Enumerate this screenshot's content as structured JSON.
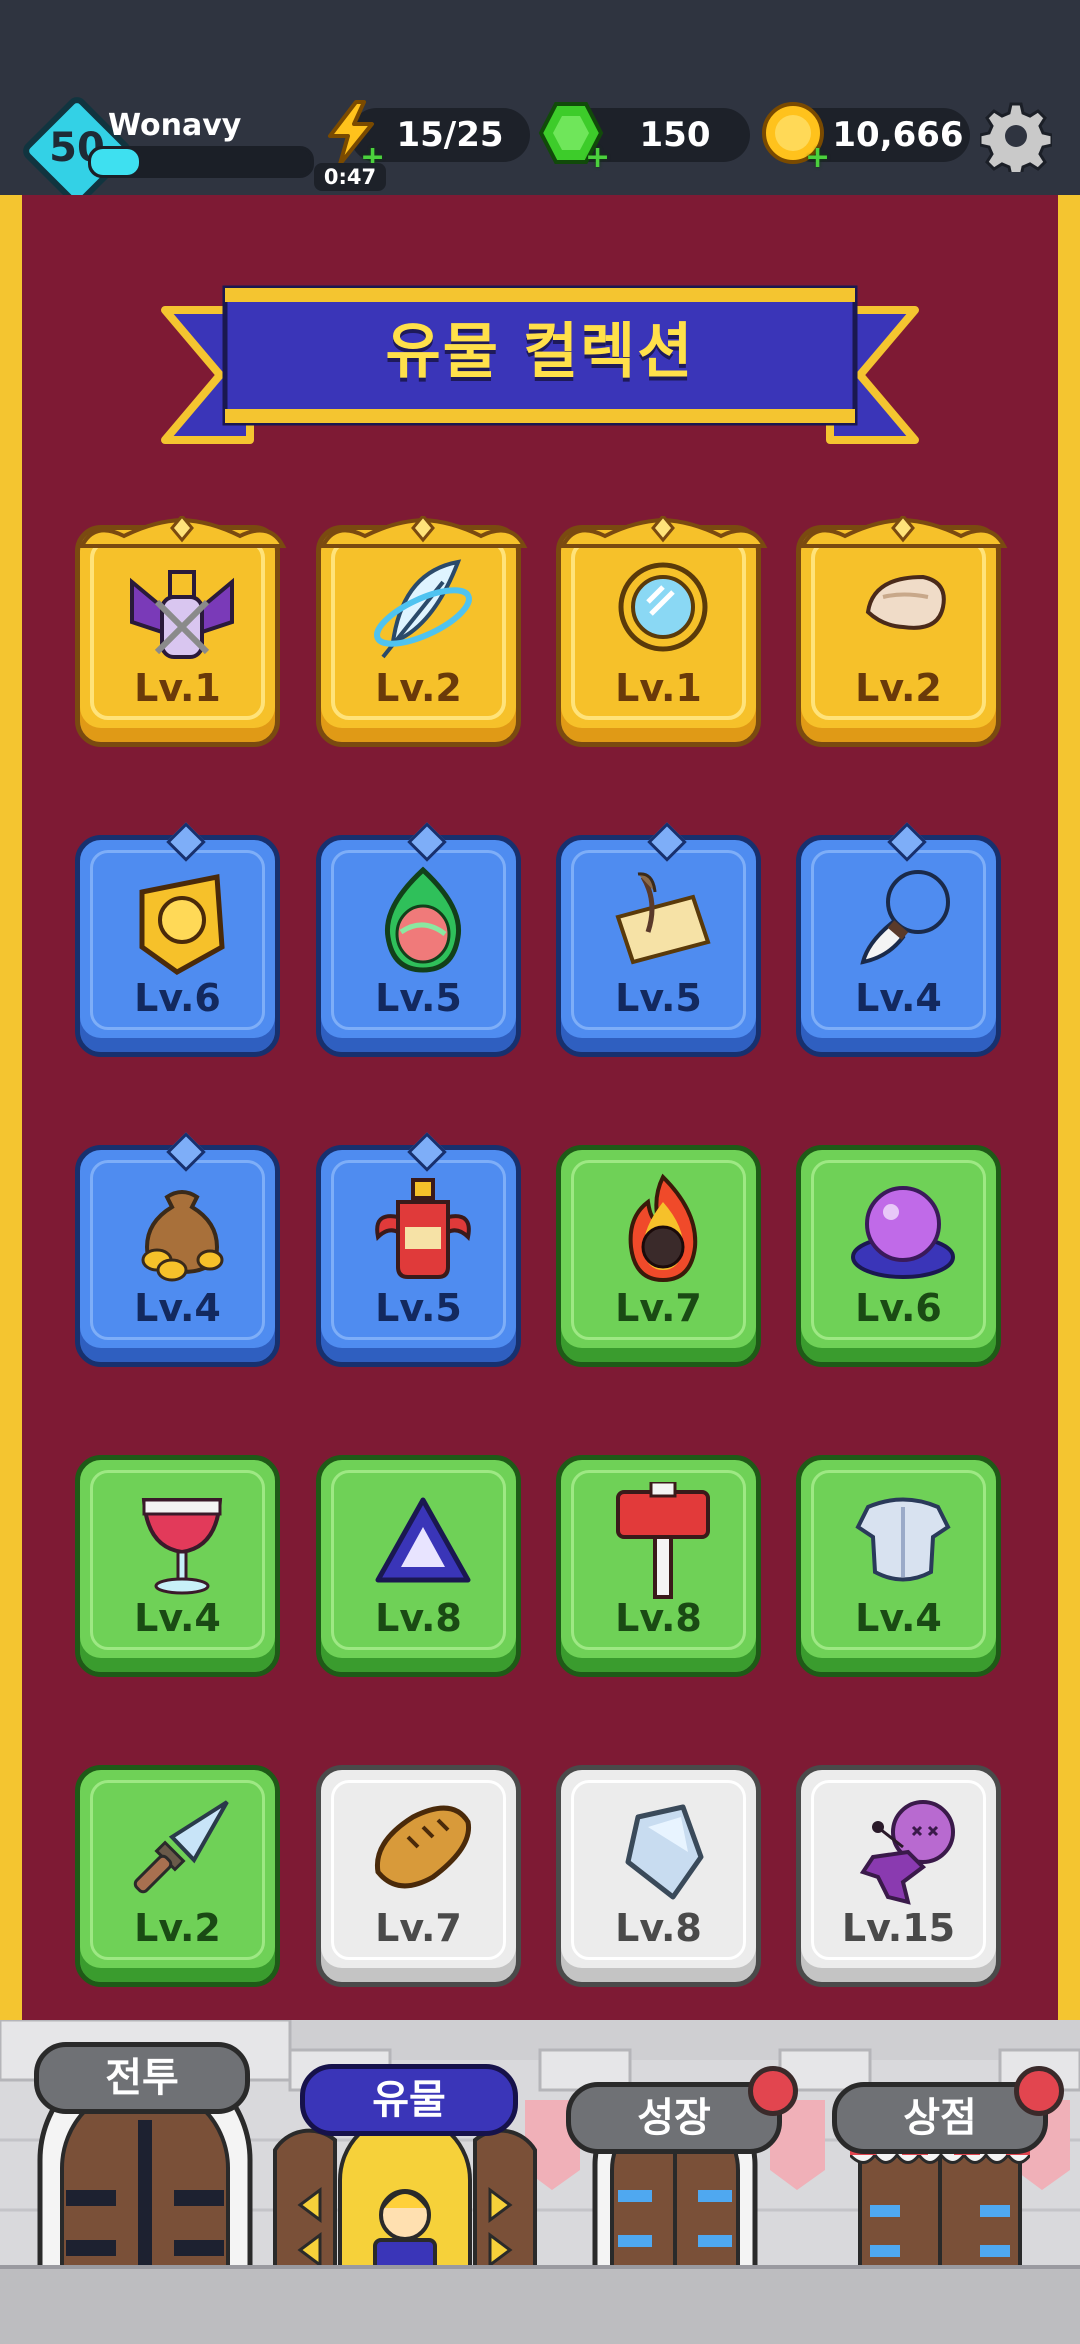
{
  "player": {
    "level": "50",
    "name": "Wonavy",
    "xp_progress": 0.22
  },
  "resources": {
    "energy": {
      "value": "15/25",
      "timer": "0:47",
      "icon": "lightning-bolt-icon"
    },
    "gems": {
      "value": "150",
      "icon": "green-gem-icon"
    },
    "gold": {
      "value": "10,666",
      "icon": "gold-coin-icon"
    }
  },
  "settings_icon": "gear-icon",
  "page": {
    "title": "유물 컬렉션"
  },
  "relics": [
    {
      "level": "Lv.1",
      "rarity": "gold",
      "icon": "chained-potion-icon"
    },
    {
      "level": "Lv.2",
      "rarity": "gold",
      "icon": "feather-icon"
    },
    {
      "level": "Lv.1",
      "rarity": "gold",
      "icon": "mirror-icon"
    },
    {
      "level": "Lv.2",
      "rarity": "gold",
      "icon": "horn-icon"
    },
    {
      "level": "Lv.6",
      "rarity": "blue",
      "icon": "gold-badge-icon"
    },
    {
      "level": "Lv.5",
      "rarity": "blue",
      "icon": "egg-icon"
    },
    {
      "level": "Lv.5",
      "rarity": "blue",
      "icon": "scroll-icon"
    },
    {
      "level": "Lv.4",
      "rarity": "blue",
      "icon": "claw-necklace-icon"
    },
    {
      "level": "Lv.4",
      "rarity": "blue",
      "icon": "money-bag-icon"
    },
    {
      "level": "Lv.5",
      "rarity": "blue",
      "icon": "horned-potion-icon"
    },
    {
      "level": "Lv.7",
      "rarity": "green",
      "icon": "fire-stone-icon"
    },
    {
      "level": "Lv.6",
      "rarity": "green",
      "icon": "crystal-ball-icon"
    },
    {
      "level": "Lv.4",
      "rarity": "green",
      "icon": "wine-glass-icon"
    },
    {
      "level": "Lv.8",
      "rarity": "green",
      "icon": "triangle-gem-icon"
    },
    {
      "level": "Lv.8",
      "rarity": "green",
      "icon": "war-hammer-icon"
    },
    {
      "level": "Lv.4",
      "rarity": "green",
      "icon": "armor-icon"
    },
    {
      "level": "Lv.2",
      "rarity": "green",
      "icon": "dagger-icon"
    },
    {
      "level": "Lv.7",
      "rarity": "white",
      "icon": "bread-icon"
    },
    {
      "level": "Lv.8",
      "rarity": "white",
      "icon": "crystal-shard-icon"
    },
    {
      "level": "Lv.15",
      "rarity": "white",
      "icon": "voodoo-doll-icon"
    }
  ],
  "nav": {
    "battle": "전투",
    "relics": "유물",
    "growth": "성장",
    "shop": "상점"
  }
}
